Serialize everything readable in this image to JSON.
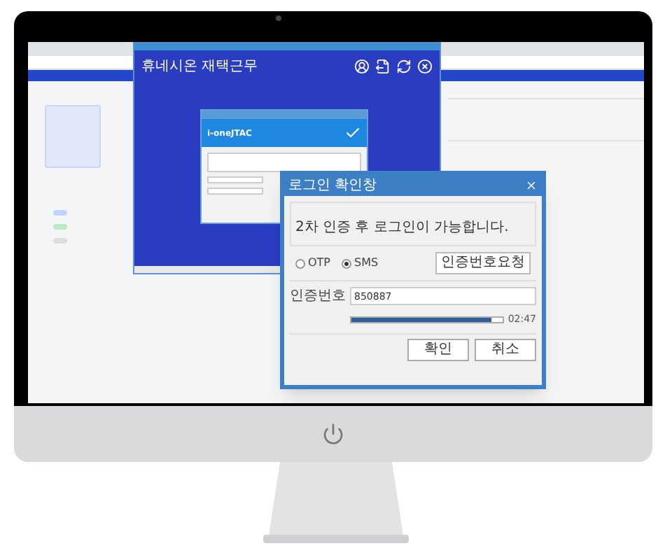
{
  "app_window": {
    "title": "휴네시온 재택근무"
  },
  "login_dialog": {
    "logo": "i-oneJTAC"
  },
  "auth_dialog": {
    "title": "로그인 확인창",
    "message": "2차 인증 후 로그인이 가능합니다.",
    "methods": [
      {
        "label": "OTP",
        "selected": false
      },
      {
        "label": "SMS",
        "selected": true
      }
    ],
    "request_button": "인증번호요청",
    "code_label": "인증번호",
    "code_value": "850887",
    "timer": {
      "level": 0.93,
      "reading": "02:47"
    },
    "buttons": [
      "확인",
      "취소"
    ]
  }
}
